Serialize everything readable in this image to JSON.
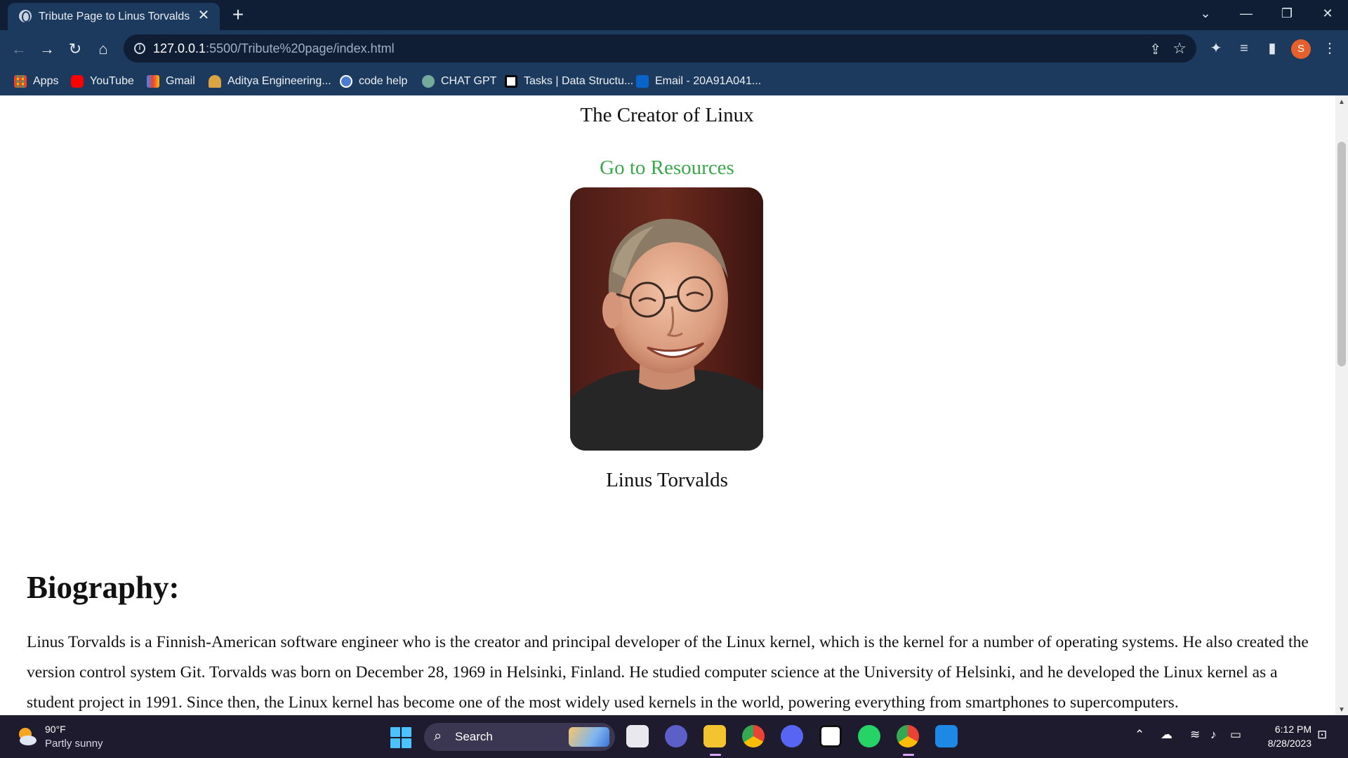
{
  "browser": {
    "tab_title": "Tribute Page to Linus Torvalds",
    "tab_close": "✕",
    "new_tab": "+",
    "url_host": "127.0.0.1",
    "url_path": ":5500/Tribute%20page/index.html",
    "profile_initial": "S",
    "bookmarks": [
      {
        "label": "Apps",
        "color": "#4285f4"
      },
      {
        "label": "YouTube",
        "color": "#ff0000"
      },
      {
        "label": "Gmail",
        "color": "#ea4335"
      },
      {
        "label": "Aditya Engineering...",
        "color": "#d9a441"
      },
      {
        "label": "code help",
        "color": "#4a7bd0"
      },
      {
        "label": "CHAT GPT",
        "color": "#74aa9c"
      },
      {
        "label": "Tasks | Data Structu...",
        "color": "#ffffff"
      },
      {
        "label": "Email - 20A91A041...",
        "color": "#0a64c8"
      }
    ]
  },
  "page": {
    "subtitle": "The Creator of Linux",
    "resources_link": "Go to Resources",
    "image_caption": "Linus Torvalds",
    "bio_heading": "Biography:",
    "bio_paragraph": "Linus Torvalds is a Finnish-American software engineer who is the creator and principal developer of the Linux kernel, which is the kernel for a number of operating systems. He also created the version control system Git. Torvalds was born on December 28, 1969 in Helsinki, Finland. He studied computer science at the University of Helsinki, and he developed the Linux kernel as a student project in 1991. Since then, the Linux kernel has become one of the most widely used kernels in the world, powering everything from smartphones to supercomputers."
  },
  "taskbar": {
    "temperature": "90°F",
    "weather": "Partly sunny",
    "search_label": "Search",
    "time": "6:12 PM",
    "date": "8/28/2023"
  },
  "colors": {
    "link_green": "#3aa84a",
    "chrome_dark": "#0f1e35",
    "chrome_toolbar": "#1c3a5e"
  }
}
